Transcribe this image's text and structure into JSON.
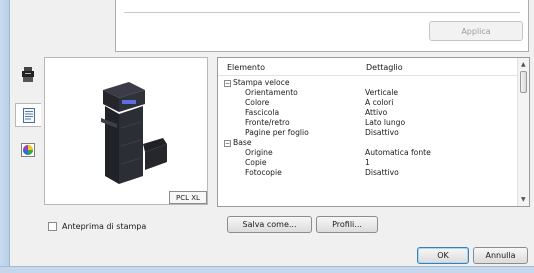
{
  "top_panel": {
    "apply_label": "Applica"
  },
  "side_tabs": [
    {
      "icon": "printer-icon"
    },
    {
      "icon": "document-icon"
    },
    {
      "icon": "color-wheel-icon"
    }
  ],
  "preview": {
    "pdl": "PCL XL"
  },
  "preview_checkbox": {
    "label": "Anteprima di stampa",
    "checked": false
  },
  "settings_tree": {
    "column_element": "Elemento",
    "column_detail": "Dettaglio",
    "groups": [
      {
        "name": "Stampa veloce",
        "collapse_glyph": "−",
        "items": [
          {
            "element": "Orientamento",
            "detail": "Verticale"
          },
          {
            "element": "Colore",
            "detail": "A colori"
          },
          {
            "element": "Fascicola",
            "detail": "Attivo"
          },
          {
            "element": "Fronte/retro",
            "detail": "Lato lungo"
          },
          {
            "element": "Pagine per foglio",
            "detail": "Disattivo"
          }
        ]
      },
      {
        "name": "Base",
        "collapse_glyph": "−",
        "items": [
          {
            "element": "Origine",
            "detail": "Automatica fonte"
          },
          {
            "element": "Copie",
            "detail": "1"
          },
          {
            "element": "Fotocopie",
            "detail": "Disattivo"
          }
        ]
      }
    ]
  },
  "buttons": {
    "save_as": "Salva come...",
    "profiles": "Profili...",
    "ok": "OK",
    "cancel": "Annulla"
  }
}
